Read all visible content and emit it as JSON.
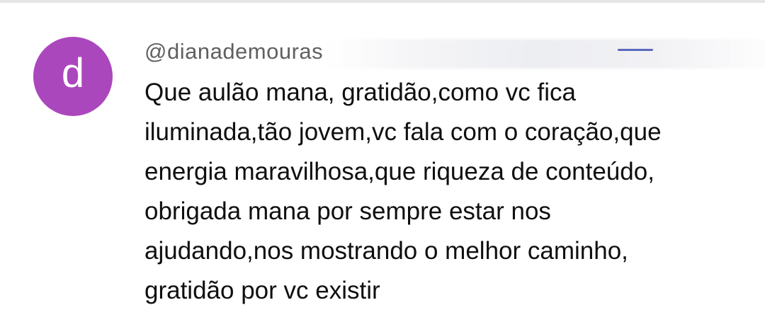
{
  "comment": {
    "avatar_letter": "d",
    "avatar_color": "#ab47bc",
    "username": "@dianademouras",
    "body_lines": [
      "Que aulão mana, gratidão,como vc fica",
      "iluminada,tão jovem,vc fala com o coração,que",
      "energia maravilhosa,que riqueza de conteúdo,",
      "obrigada mana por sempre estar nos",
      "ajudando,nos mostrando o melhor caminho,",
      "gratidão por vc existir"
    ]
  }
}
